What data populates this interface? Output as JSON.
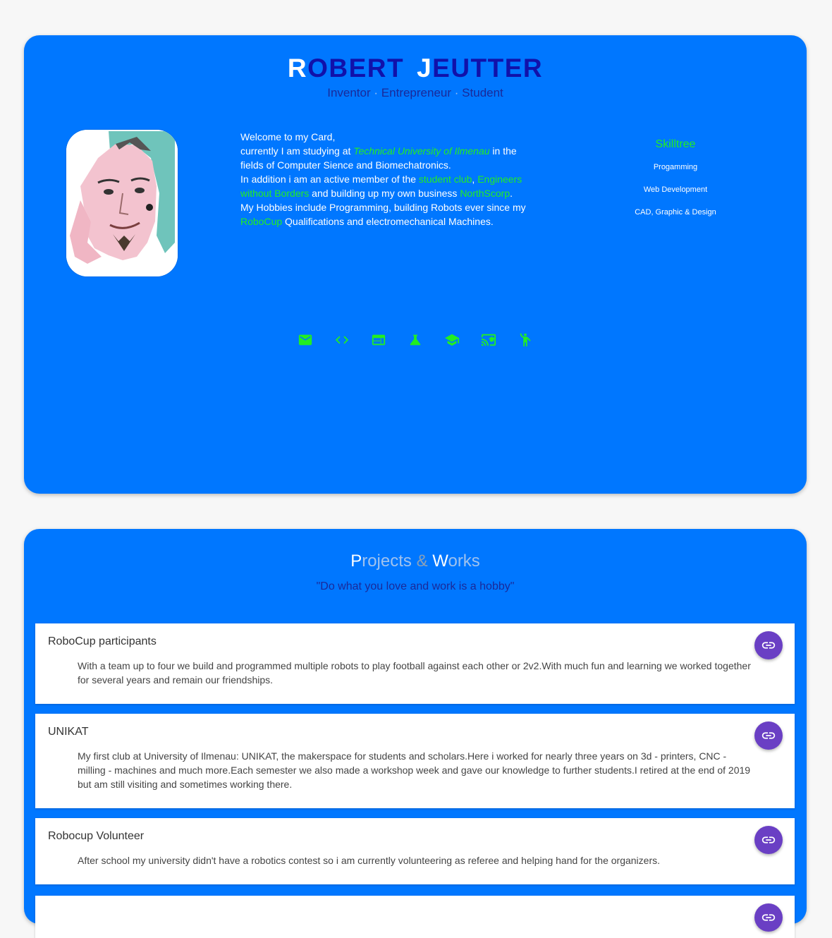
{
  "profile": {
    "name_first_initial": "R",
    "name_first_rest": "OBERT",
    "name_last_initial": "J",
    "name_last_rest": "EUTTER",
    "subtitle": {
      "role1": "Inventor",
      "role2": "Entrepreneur",
      "role3": "Student",
      "separator": "·"
    },
    "intro": {
      "l1": "Welcome to my Card,",
      "l2a": "currently I am studying at ",
      "university": "Technical University of Ilmenau",
      "l2b": " in the fields of Computer Sience and Biomechatronics.",
      "l3a": "In addition i am an active member of the ",
      "club": "student club",
      "comma": ", ",
      "ewb": "Engineers without Borders",
      "l3b": " and building up my own business ",
      "business": "NorthScorp",
      "period": ".",
      "l4a": "My Hobbies include Programming, building Robots ever since my ",
      "robocup": "RoboCup",
      "l4b": " Qualifications and electromechanical Machines."
    },
    "skilltree": {
      "title": "Skilltree",
      "items": [
        "Progamming",
        "Web Development",
        "CAD, Graphic & Design"
      ]
    },
    "social_icons": [
      "mail-icon",
      "code-icon",
      "web-icon",
      "science-icon",
      "school-icon",
      "cast-for-education-icon",
      "accessibility-icon"
    ]
  },
  "projects": {
    "title_p": "P",
    "title_rest1": "rojects",
    "amp": "&",
    "title_w": "W",
    "title_rest2": "orks",
    "quote": "\"Do what you love and work is a hobby\"",
    "items": [
      {
        "title": "RoboCup participants",
        "description": "With a team up to four we build and programmed multiple robots to play football against each other or 2v2.With much fun and learning we worked together for several years and remain our friendships."
      },
      {
        "title": "UNIKAT",
        "description": "My first club at University of Ilmenau: UNIKAT, the makerspace for students and scholars.Here i worked for nearly three years on 3d - printers, CNC - milling - machines and much more.Each semester we also made a workshop week and gave our knowledge to further students.I retired at the end of 2019 but am still visiting and sometimes working there."
      },
      {
        "title": "Robocup Volunteer",
        "description": "After school my university didn't have a robotics contest so i am currently volunteering as referee and helping hand for the organizers."
      },
      {
        "title": "",
        "description": ""
      }
    ]
  },
  "colors": {
    "card_bg": "#0077ff",
    "accent_green": "#22ee22",
    "name_dark": "#1111aa",
    "link_button": "#6a3fc4"
  }
}
